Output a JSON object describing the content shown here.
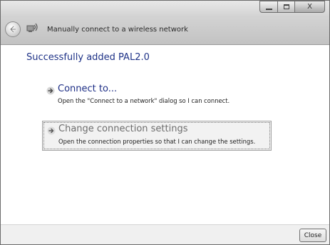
{
  "window": {
    "title": "Manually connect to a wireless network",
    "controls": {
      "minimize_icon": "minimize-icon",
      "maximize_icon": "maximize-icon",
      "close_glyph": "X"
    },
    "back_icon": "back-arrow-icon",
    "app_icon": "wireless-network-icon"
  },
  "main": {
    "heading": "Successfully added PAL2.0",
    "options": [
      {
        "title": "Connect to...",
        "description": "Open the \"Connect to a network\" dialog so I can connect.",
        "icon": "green-arrow-icon"
      },
      {
        "title": "Change connection settings",
        "description": "Open the connection properties so that I can change the settings.",
        "icon": "green-arrow-icon"
      }
    ]
  },
  "footer": {
    "close_label": "Close"
  },
  "colors": {
    "link": "#1e2f86",
    "heading": "#1e3287",
    "footer_bg": "#f0f0f0"
  }
}
